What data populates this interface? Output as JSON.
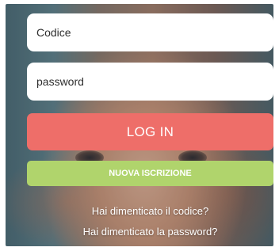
{
  "login_form": {
    "code_placeholder": "Codice",
    "password_placeholder": "password",
    "login_label": "LOG IN",
    "signup_label": "NUOVA ISCRIZIONE",
    "forgot_code_link": "Hai dimenticato il codice?",
    "forgot_password_link": "Hai dimenticato la password?"
  },
  "colors": {
    "login_button": "#ee6e69",
    "signup_button": "#b0d46c"
  }
}
